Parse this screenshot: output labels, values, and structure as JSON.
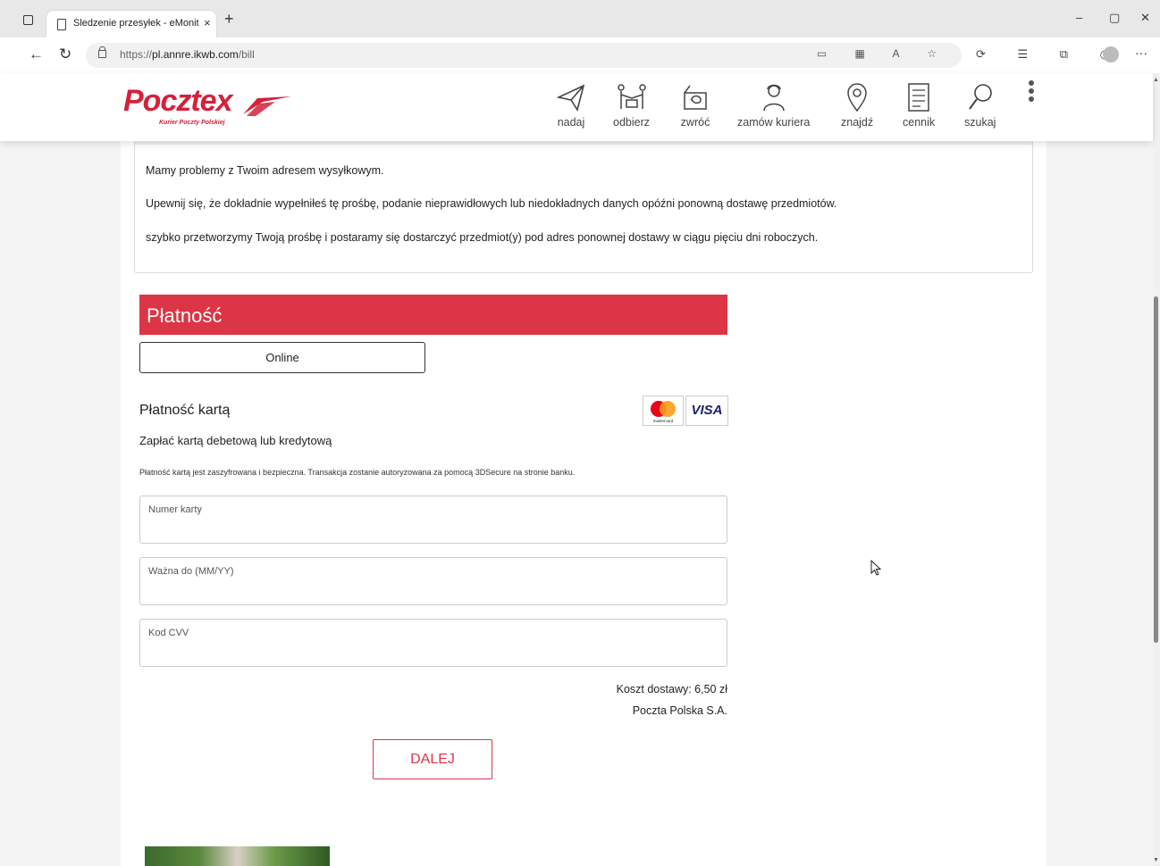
{
  "browser": {
    "tab_title": "Śledzenie przesyłek - eMonitorin",
    "tab_close": "×",
    "new_tab": "+",
    "url_prefix": "https://",
    "url_host": "pl.annre.ikwb.com",
    "url_path": "/bill",
    "window_controls": [
      "–",
      "▢",
      "✕"
    ]
  },
  "site": {
    "logo_text": "Pocztex",
    "logo_sub": "Kurier Poczty Polskiej",
    "nav": [
      {
        "label": "nadaj",
        "icon": "paper-plane-icon"
      },
      {
        "label": "odbierz",
        "icon": "pickup-icon"
      },
      {
        "label": "zwróć",
        "icon": "return-icon"
      },
      {
        "label": "zamów kuriera",
        "icon": "courier-icon"
      },
      {
        "label": "znajdź",
        "icon": "location-pin-icon"
      },
      {
        "label": "cennik",
        "icon": "price-list-icon"
      },
      {
        "label": "szukaj",
        "icon": "search-icon"
      }
    ]
  },
  "message": {
    "line1": "Mamy problemy z Twoim adresem wysyłkowym.",
    "line2": "Upewnij się, że dokładnie wypełniłeś tę prośbę, podanie nieprawidłowych lub niedokładnych danych opóźni ponowną dostawę przedmiotów.",
    "line3": "szybko przetworzymy Twoją prośbę i postaramy się dostarczyć przedmiot(y) pod adres ponownej dostawy w ciągu pięciu dni roboczych."
  },
  "payment": {
    "header": "Płatność",
    "method_button": "Online",
    "card_title": "Płatność kartą",
    "card_sub": "Zapłać kartą debetową lub kredytową",
    "card_note": "Płatność kartą jest zaszyfrowana i bezpieczna. Transakcja zostanie autoryzowana za pomocą 3DSecure na stronie banku.",
    "visa_label": "VISA",
    "mastercard_label": "mastercard",
    "fields": {
      "card_number": {
        "label": "Numer karty",
        "value": ""
      },
      "expiry": {
        "label": "Ważna do (MM/YY)",
        "value": ""
      },
      "cvv": {
        "label": "Kod CVV",
        "value": ""
      }
    },
    "delivery_cost": "Koszt dostawy: 6,50 zł",
    "company": "Poczta Polska S.A.",
    "submit": "DALEJ"
  },
  "colors": {
    "brand_red": "#dc3545",
    "logo_red": "#d6203a",
    "visa_blue": "#1a1f71"
  }
}
